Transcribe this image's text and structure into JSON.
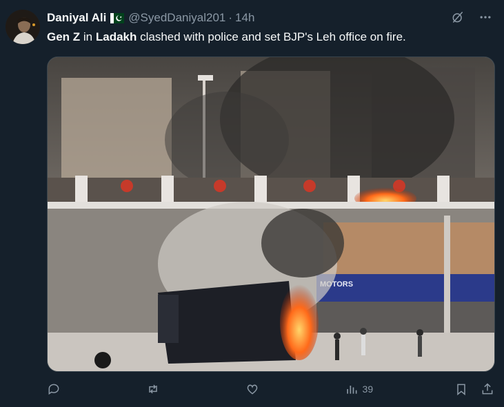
{
  "author": {
    "name": "Daniyal Ali",
    "handle": "@SyedDaniyal201",
    "separator": "·",
    "time": "14h"
  },
  "tweet": {
    "parts": [
      {
        "text": "Gen Z",
        "bold": true
      },
      {
        "text": " in ",
        "bold": false
      },
      {
        "text": "Ladakh",
        "bold": true
      },
      {
        "text": " clashed with police and set BJP's Leh office on fire.",
        "bold": false
      }
    ]
  },
  "media": {
    "sign_text": "MOTORS"
  },
  "actions": {
    "reply_count": "",
    "retweet_count": "",
    "like_count": "",
    "views_count": "39"
  },
  "icons": {
    "grok": "grok-icon",
    "more": "more-icon",
    "reply": "reply-icon",
    "retweet": "retweet-icon",
    "like": "like-icon",
    "views": "views-icon",
    "bookmark": "bookmark-icon",
    "share": "share-icon"
  },
  "colors": {
    "background": "#15202b",
    "text_primary": "#f7f9f9",
    "text_secondary": "#8b98a5",
    "border": "#38444d"
  }
}
